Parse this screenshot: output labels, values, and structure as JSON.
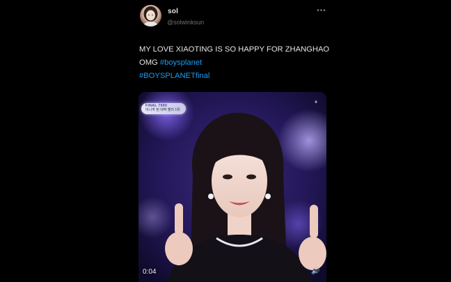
{
  "user": {
    "display_name": "sol",
    "handle": "@solwinksun",
    "more_icon": "more-horizontal-icon"
  },
  "tweet": {
    "text_plain": "MY LOVE XIAOTING IS SO HAPPY FOR ZHANGHAO OMG ",
    "hashtag_1": "#boysplanet",
    "hashtag_2": "#BOYSPLANETfinal"
  },
  "media": {
    "badge_line1": "FINAL 7000",
    "badge_line2": "이니까 된 대박 웬리 1위",
    "duration": "0:04",
    "top_icon": "gif-indicator-icon",
    "sound_icon": "volume-icon"
  },
  "colors": {
    "background": "#000000",
    "text": "#e6e6e6",
    "link": "#1d9bf0",
    "muted": "#6e6e6e",
    "stage": "#1a1040"
  }
}
